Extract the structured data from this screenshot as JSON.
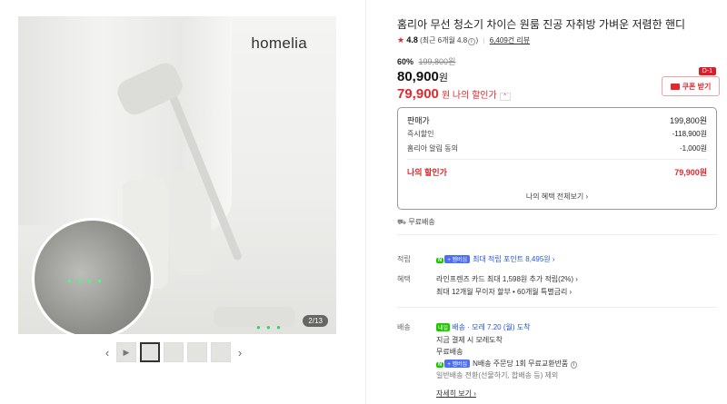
{
  "gallery": {
    "brand": "homelia",
    "counter": "2/13",
    "prev_arrow": "‹",
    "next_arrow": "›"
  },
  "product": {
    "title": "홈리아 무선 청소기 차이슨 원룸 진공 자취방 가벼운 저렴한 핸디",
    "rating": "4.8",
    "rating_recent": "(최근 6개월 4.8",
    "info_mark": "i",
    "rating_close": ")",
    "reviews": "6,409건 리뷰",
    "discount_pct": "60%",
    "original_price": "199,800원",
    "price": "80,900",
    "price_unit": "원",
    "my_price": "79,900",
    "my_price_unit": "원 나의 할인가",
    "my_price_chevron": "⌃"
  },
  "coupon": {
    "d_badge": "D-1",
    "button": "쿠폰 받기"
  },
  "breakdown": {
    "seller_label": "판매가",
    "seller_value": "199,800원",
    "instant_label": "즉시할인",
    "instant_value": "-118,900원",
    "alarm_label": "홈리아 알림 동의",
    "alarm_value": "-1,000원",
    "my_label": "나의 할인가",
    "my_value": "79,900원",
    "benefit_link": "나의 혜택 전체보기 ›"
  },
  "shipping_free": "무료배송",
  "points": {
    "label": "적립",
    "npay": "N",
    "plus": "+ 멤버십",
    "text": "최대 적립 포인트 8,495원 ›"
  },
  "benefit": {
    "label": "혜택",
    "line1": "라인프렌즈 카드 최대 1,598원 추가 적립(2%) ›",
    "line2": "최대 12개월 무이자 할부 • 60개월 특별금리 ›"
  },
  "delivery": {
    "label": "배송",
    "nextday": "내일",
    "arrival": "배송 · 모레 7.20 (월) 도착",
    "line1": "지금 결제 시 모레도착",
    "line2": "무료배송",
    "npay": "N",
    "plus": "+ 멤버십",
    "line3": "N배송 주문당 1회 무료교환반품",
    "info_mark": "i",
    "line4": "일반배송 전환(선물하기, 합배송 등) 제외",
    "detail_link": "자세히 보기 ›"
  },
  "colors": {
    "accent_red": "#e0282e",
    "npay_green": "#1ec800",
    "membership_blue": "#4b6ef5"
  }
}
